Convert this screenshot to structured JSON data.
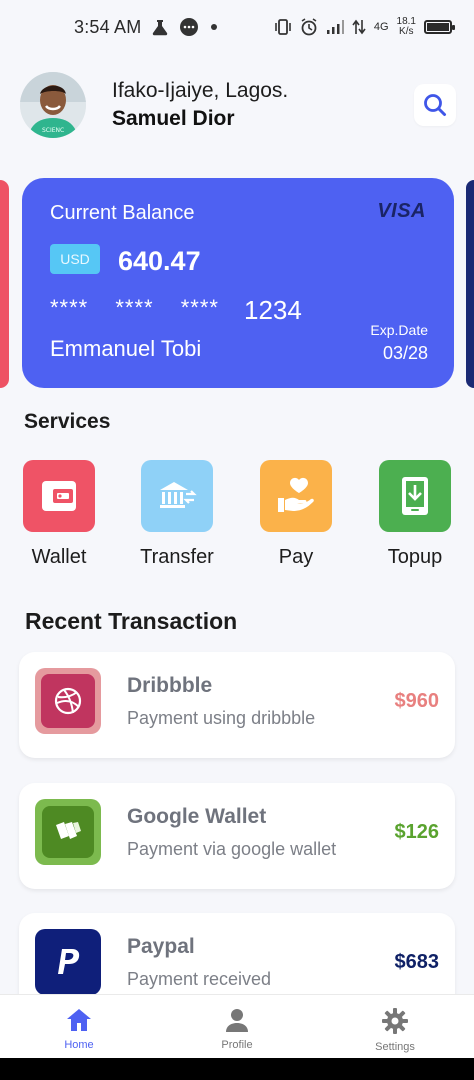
{
  "status_bar": {
    "time": "3:54 AM",
    "network": "4G",
    "speed_value": "18.1",
    "speed_unit": "K/s",
    "icons": [
      "flask-icon",
      "chat-bubble-icon",
      "dot-icon",
      "vibrate-icon",
      "alarm-icon",
      "signal-icon",
      "data-arrows-icon",
      "battery-icon"
    ]
  },
  "header": {
    "location": "Ifako-Ijaiye, Lagos.",
    "name": "Samuel Dior",
    "search_icon": "search-icon"
  },
  "card": {
    "label": "Current Balance",
    "brand": "VISA",
    "currency": "USD",
    "amount": "640.47",
    "masked": [
      "****",
      "****",
      "****"
    ],
    "last4": "1234",
    "holder": "Emmanuel Tobi",
    "exp_label": "Exp.Date",
    "exp_value": "03/28",
    "color": "#4e61f2"
  },
  "services": {
    "title": "Services",
    "items": [
      {
        "label": "Wallet",
        "icon": "wallet-icon",
        "color": "#ef5366"
      },
      {
        "label": "Transfer",
        "icon": "bank-transfer-icon",
        "color": "#8fd1f7"
      },
      {
        "label": "Pay",
        "icon": "hand-heart-icon",
        "color": "#fbb24a"
      },
      {
        "label": "Topup",
        "icon": "download-phone-icon",
        "color": "#4caf50"
      }
    ]
  },
  "recent": {
    "title": "Recent Transaction",
    "items": [
      {
        "name": "Dribbble",
        "desc": "Payment using dribbble",
        "amount": "$960",
        "amount_color": "#e8807f",
        "icon": "dribbble-icon"
      },
      {
        "name": "Google Wallet",
        "desc": "Payment via google wallet",
        "amount": "$126",
        "amount_color": "#5aa32f",
        "icon": "google-wallet-icon"
      },
      {
        "name": "Paypal",
        "desc": "Payment received",
        "amount": "$683",
        "amount_color": "#0f2166",
        "icon": "paypal-icon"
      }
    ]
  },
  "nav": {
    "items": [
      {
        "label": "Home",
        "icon": "home-icon",
        "active": true
      },
      {
        "label": "Profile",
        "icon": "person-icon",
        "active": false
      },
      {
        "label": "Settings",
        "icon": "gear-icon",
        "active": false
      }
    ]
  }
}
